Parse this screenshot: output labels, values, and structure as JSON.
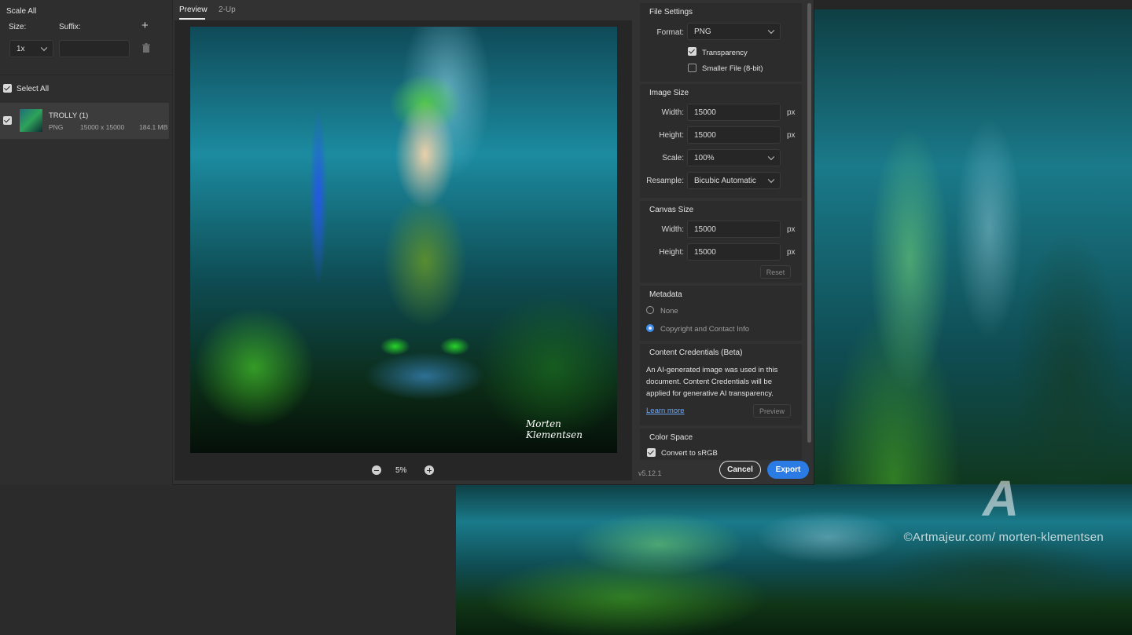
{
  "left_panel": {
    "header": "Scale All",
    "size_label": "Size:",
    "suffix_label": "Suffix:",
    "size_value": "1x",
    "suffix_value": "",
    "select_all_label": "Select All",
    "files": [
      {
        "name": "TROLLY (1)",
        "format": "PNG",
        "dimensions": "15000 x 15000",
        "size": "184.1 MB"
      }
    ]
  },
  "preview": {
    "tabs": [
      "Preview",
      "2-Up"
    ],
    "active_tab": "Preview",
    "signature": "Morten Klementsen",
    "zoom": "5%"
  },
  "settings": {
    "file_settings": {
      "title": "File Settings",
      "format_label": "Format:",
      "format_value": "PNG",
      "transparency_label": "Transparency",
      "transparency_checked": true,
      "smaller_file_label": "Smaller File (8-bit)",
      "smaller_file_checked": false
    },
    "image_size": {
      "title": "Image Size",
      "width_label": "Width:",
      "width_value": "15000",
      "height_label": "Height:",
      "height_value": "15000",
      "scale_label": "Scale:",
      "scale_value": "100%",
      "resample_label": "Resample:",
      "resample_value": "Bicubic Automatic",
      "unit": "px"
    },
    "canvas_size": {
      "title": "Canvas Size",
      "width_label": "Width:",
      "width_value": "15000",
      "height_label": "Height:",
      "height_value": "15000",
      "unit": "px",
      "reset_label": "Reset"
    },
    "metadata": {
      "title": "Metadata",
      "options": [
        "None",
        "Copyright and Contact Info"
      ],
      "selected": "Copyright and Contact Info"
    },
    "content_credentials": {
      "title": "Content Credentials (Beta)",
      "body": "An AI-generated image was used in this document. Content Credentials will be applied for generative AI transparency.",
      "learn_more": "Learn more",
      "preview_label": "Preview"
    },
    "color_space": {
      "title": "Color Space",
      "convert_label": "Convert to sRGB",
      "convert_checked": true
    }
  },
  "footer": {
    "version": "v5.12.1",
    "cancel": "Cancel",
    "export": "Export"
  },
  "background": {
    "watermark": "©Artmajeur.com/ morten-klementsen"
  },
  "colors": {
    "accent": "#2b7be4",
    "dialog_bg": "#323232",
    "panel_bg": "#2c2c2c"
  }
}
